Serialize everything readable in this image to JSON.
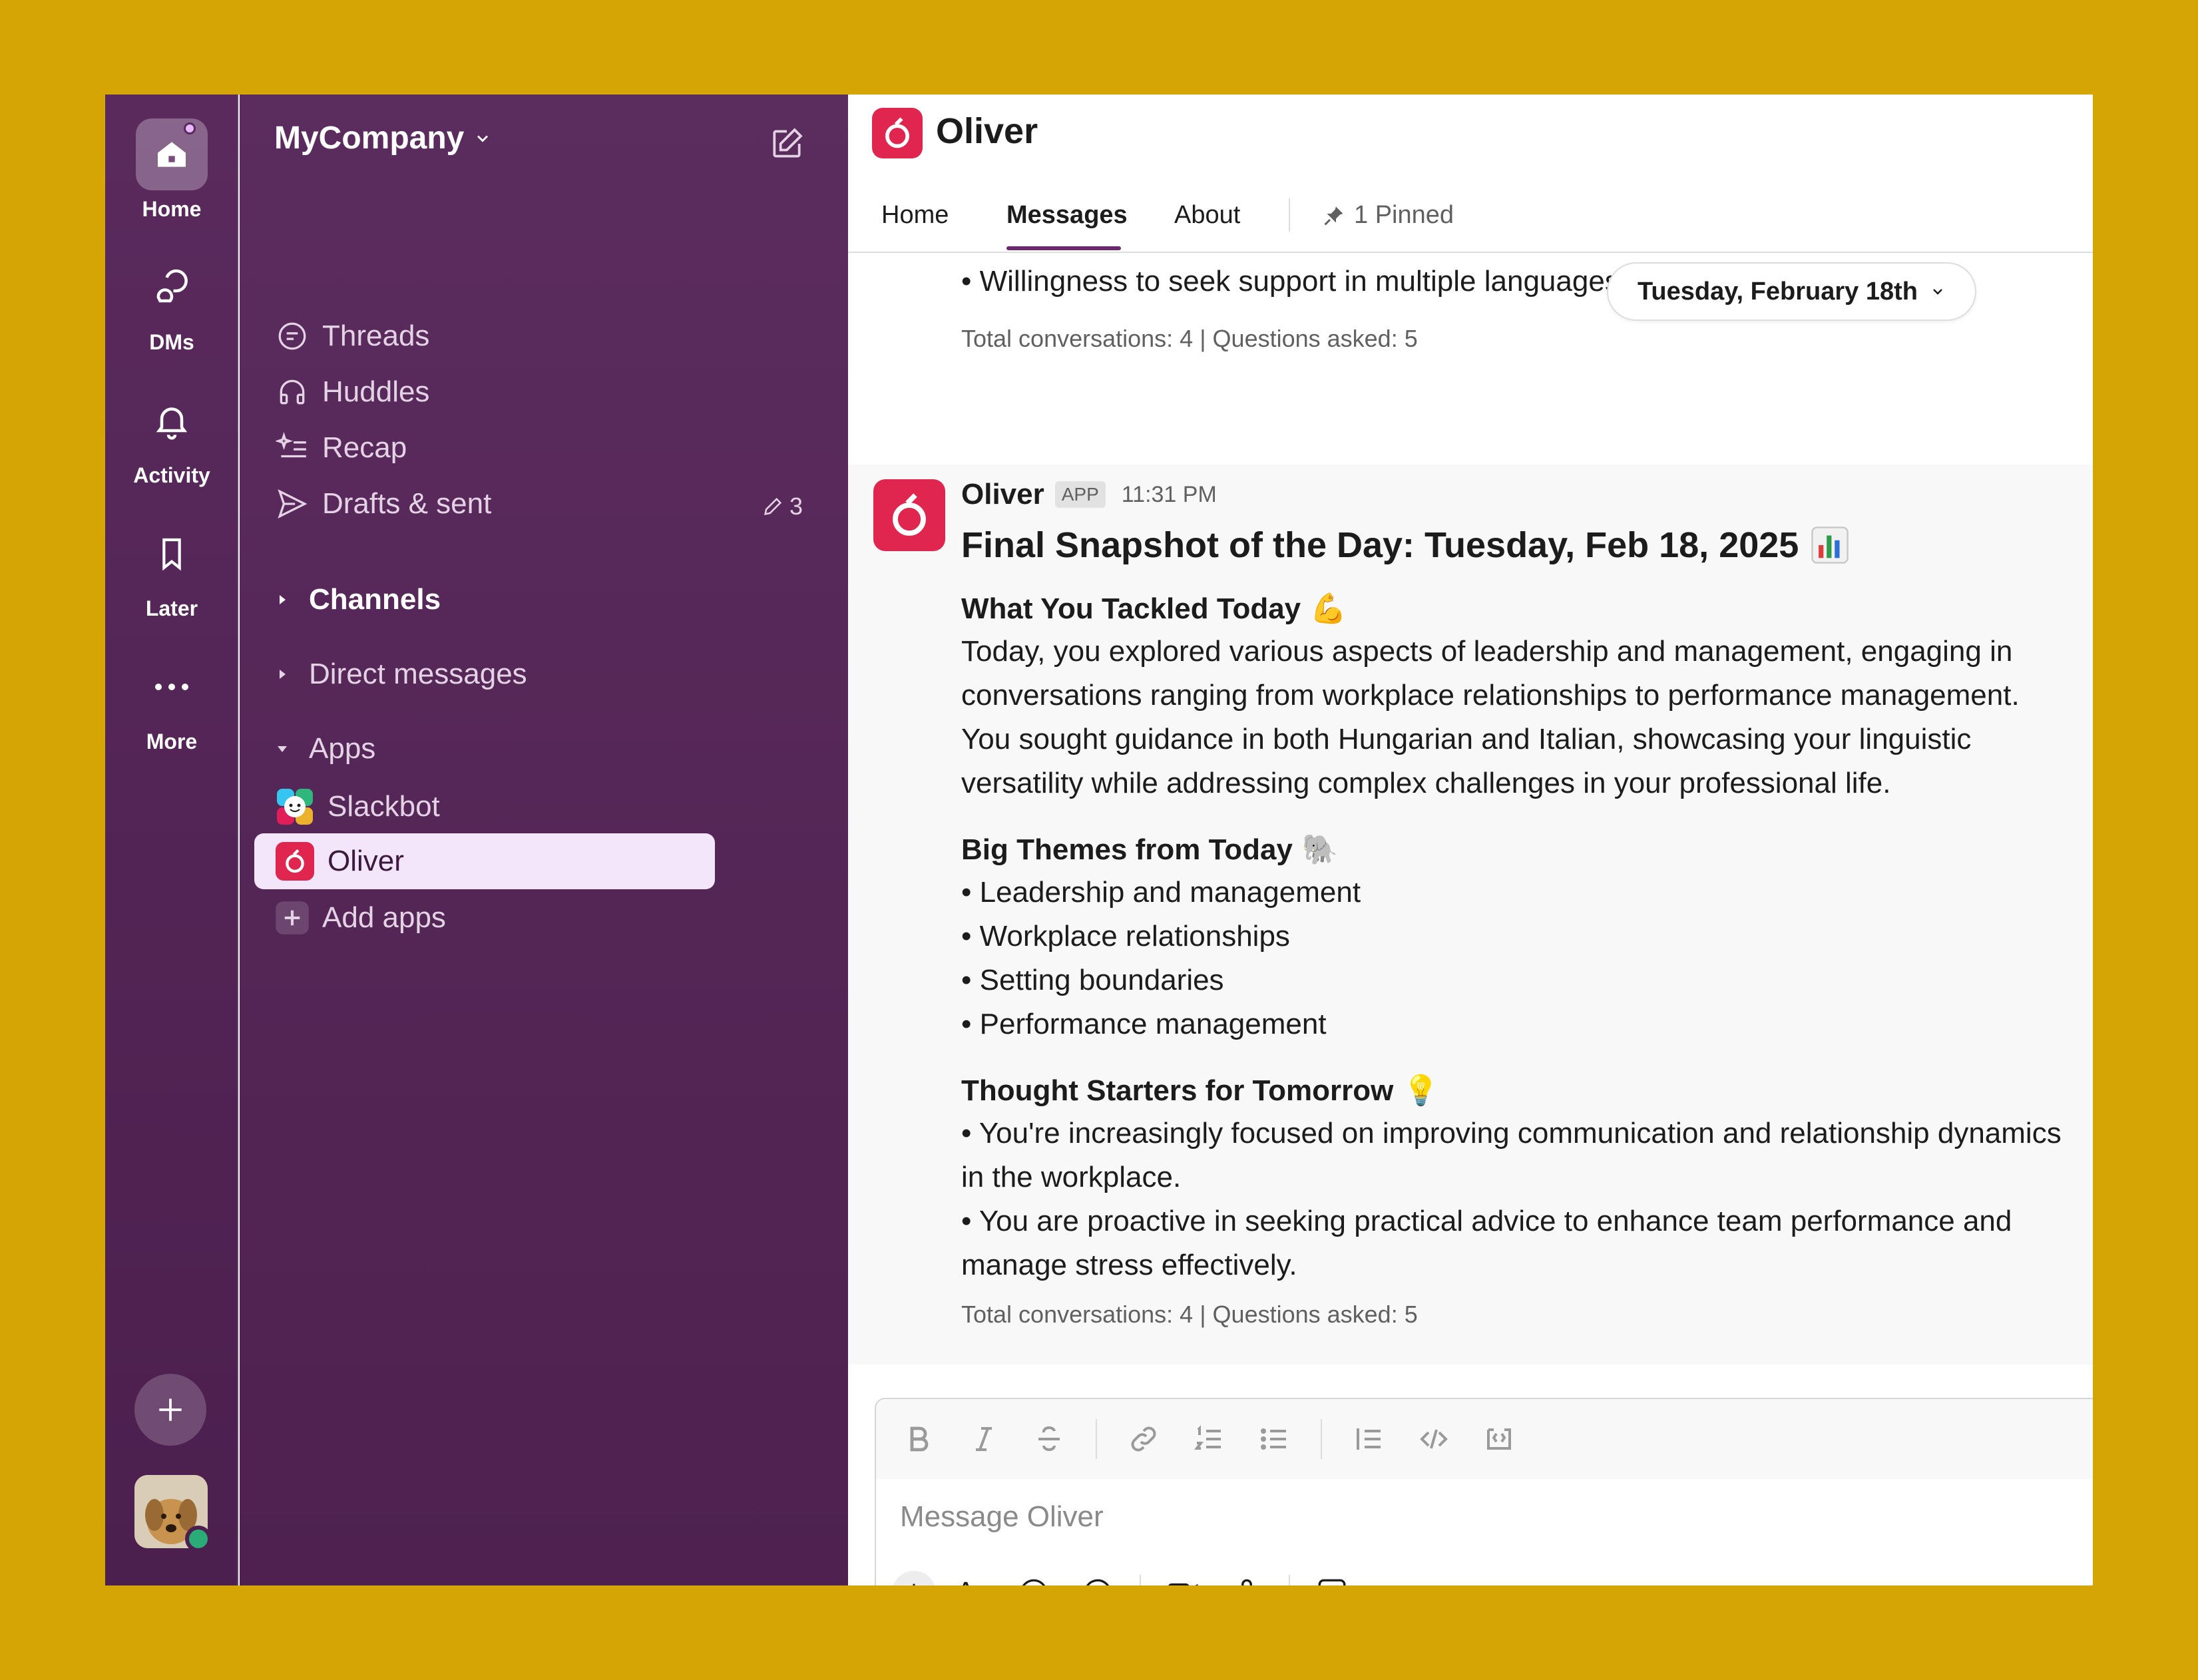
{
  "rail": {
    "items": [
      {
        "label": "Home"
      },
      {
        "label": "DMs"
      },
      {
        "label": "Activity"
      },
      {
        "label": "Later"
      },
      {
        "label": "More"
      }
    ]
  },
  "sidebar": {
    "workspace": "MyCompany",
    "nav": [
      {
        "label": "Threads",
        "icon": "threads-icon"
      },
      {
        "label": "Huddles",
        "icon": "headphones-icon"
      },
      {
        "label": "Recap",
        "icon": "sparkle-list-icon"
      },
      {
        "label": "Drafts & sent",
        "icon": "send-icon"
      }
    ],
    "drafts_count": "3",
    "channels_label": "Channels",
    "dms_label": "Direct messages",
    "apps_label": "Apps",
    "apps": [
      {
        "label": "Slackbot"
      },
      {
        "label": "Oliver"
      }
    ],
    "add_apps": "Add apps"
  },
  "header": {
    "title": "Oliver",
    "tabs": [
      {
        "label": "Home"
      },
      {
        "label": "Messages"
      },
      {
        "label": "About"
      }
    ],
    "pinned": "1 Pinned"
  },
  "feed": {
    "prev_bullet": "• Willingness to seek support in multiple languages",
    "prev_meta": "Total conversations: 4 | Questions asked: 5",
    "date_pill": "Tuesday, February 18th",
    "message": {
      "sender": "Oliver",
      "badge": "APP",
      "time": "11:31 PM",
      "title": "Final Snapshot of the Day: Tuesday, Feb 18, 2025",
      "sections": [
        {
          "title": "What You Tackled Today",
          "emoji": "💪",
          "paragraph": "Today, you explored various aspects of leadership and management, engaging in conversations ranging from workplace relationships to performance management. You sought guidance in both Hungarian and Italian, showcasing your linguistic versatility while addressing complex challenges in your professional life."
        },
        {
          "title": "Big Themes from Today",
          "emoji": "🐘",
          "bullets": [
            "• Leadership and management",
            "• Workplace relationships",
            "• Setting boundaries",
            "• Performance management"
          ]
        },
        {
          "title": "Thought Starters for Tomorrow",
          "emoji": "💡",
          "bullets": [
            "• You're increasingly focused on improving communication and relationship dynamics in the workplace.",
            "• You are proactive in seeking practical advice to enhance team performance and manage stress effectively."
          ]
        }
      ],
      "meta": "Total conversations: 4 | Questions asked: 5"
    }
  },
  "composer": {
    "placeholder": "Message Oliver",
    "format_label": "Aa"
  },
  "colors": {
    "frame": "#d4a504",
    "sidebar": "#4e2150",
    "accent": "#6a2b6d",
    "oliver_red": "#e0264f",
    "active_row": "#f4e6fa",
    "online": "#2bac76"
  }
}
